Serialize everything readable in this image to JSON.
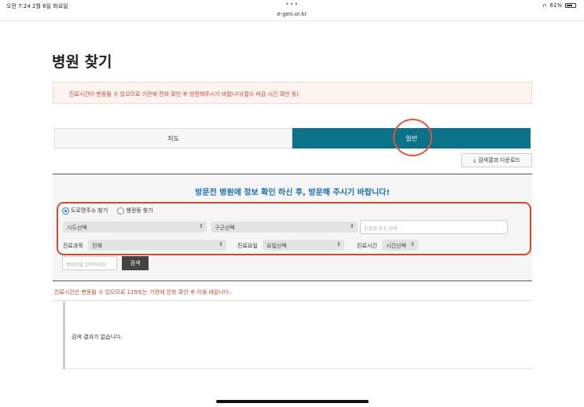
{
  "status_bar": {
    "time": "오전 7:24   2월 6일 화요일",
    "url": "e-gen.or.kr",
    "battery": "61%"
  },
  "page": {
    "title": "병원 찾기",
    "notice": "진료시간이 변동될 수 있으므로 기관에 전화 확인 후 방문해주시기 바랍니다(접수 마감 시간 확인 등).",
    "tabs": [
      "지도",
      "일반"
    ],
    "download_label": "검색결과 다운로드"
  },
  "search": {
    "heading": "방문전 병원에 정보 확인 하신 후, 방문해 주시기 바랍니다!",
    "radio_road": "도로명주소 찾기",
    "radio_admin": "행정동 찾기",
    "sido_value": "시도선택",
    "gugun_value": "구군선택",
    "road_placeholder": "도로명 주소 입력",
    "dept_label": "진료과목",
    "dept_value": "전체",
    "day_label": "진료요일",
    "day_value": "요일선택",
    "time_label": "진료시간",
    "time_value": "시간선택",
    "name_placeholder": "병원명을 입력하세요",
    "search_label": "검색"
  },
  "results": {
    "warning": "진료시간은 변동될 수 있으므로 119또는 기관에 전화 확인 후 이용 바랍니다.",
    "empty_message": "검색 결과가 없습니다."
  },
  "colors": {
    "accent": "#0b7289",
    "highlight_red": "#d64a33",
    "heading_blue": "#1a6fb3"
  }
}
